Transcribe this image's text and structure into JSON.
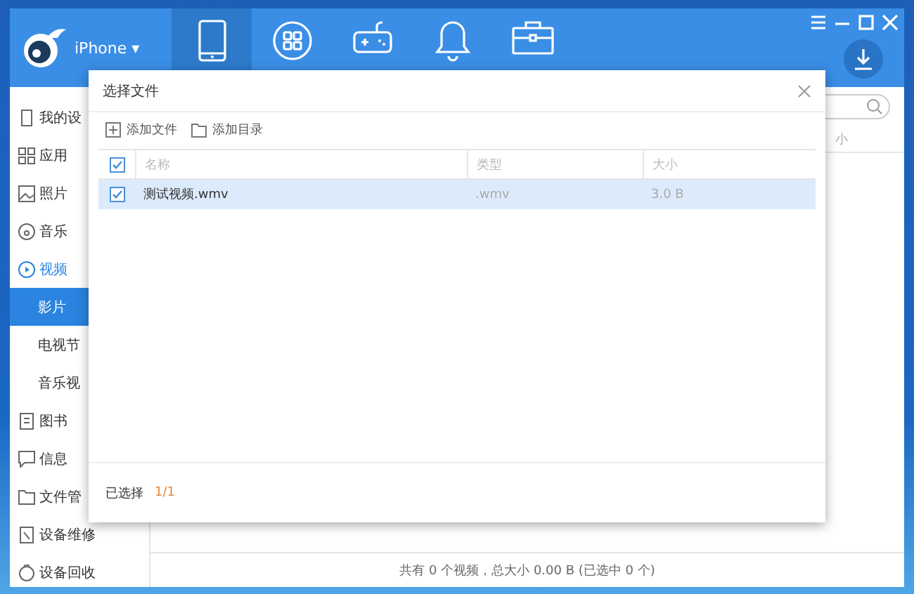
{
  "header": {
    "device": "iPhone ▾",
    "nav": [
      {
        "kind": "tablet",
        "selected": true
      },
      {
        "kind": "apps",
        "selected": false
      },
      {
        "kind": "games",
        "selected": false
      },
      {
        "kind": "bell",
        "selected": false
      },
      {
        "kind": "toolbox",
        "selected": false
      }
    ]
  },
  "sidebar": {
    "items": [
      {
        "kind": "device",
        "label": "我的设",
        "active": false
      },
      {
        "kind": "apps",
        "label": "应用",
        "active": false
      },
      {
        "kind": "photos",
        "label": "照片",
        "active": false
      },
      {
        "kind": "music",
        "label": "音乐",
        "active": false
      },
      {
        "kind": "video",
        "label": "视频",
        "active": true,
        "children": [
          {
            "label": "影片",
            "selected": true
          },
          {
            "label": "电视节",
            "selected": false
          },
          {
            "label": "音乐视",
            "selected": false
          }
        ]
      },
      {
        "kind": "books",
        "label": "图书",
        "active": false
      },
      {
        "kind": "messages",
        "label": "信息",
        "active": false
      },
      {
        "kind": "files",
        "label": "文件管",
        "active": false
      },
      {
        "kind": "repair",
        "label": "设备维修",
        "active": false
      },
      {
        "kind": "recycle",
        "label": "设备回收",
        "active": false
      }
    ]
  },
  "content": {
    "columns": [
      "小"
    ],
    "status_bar": "共有 0 个视频，总大小 0.00 B (已选中 0 个)"
  },
  "dialog": {
    "title": "选择文件",
    "toolbar": [
      {
        "kind": "add-file",
        "label": "添加文件"
      },
      {
        "kind": "add-folder",
        "label": "添加目录"
      }
    ],
    "table": {
      "all_checked": true,
      "columns": [
        "名称",
        "类型",
        "大小"
      ],
      "rows": [
        {
          "checked": true,
          "selected": true,
          "cells": [
            "测试视频.wmv",
            ".wmv",
            "3.0 B"
          ]
        }
      ]
    },
    "footer": {
      "label": "已选择",
      "count": "1/1"
    }
  }
}
